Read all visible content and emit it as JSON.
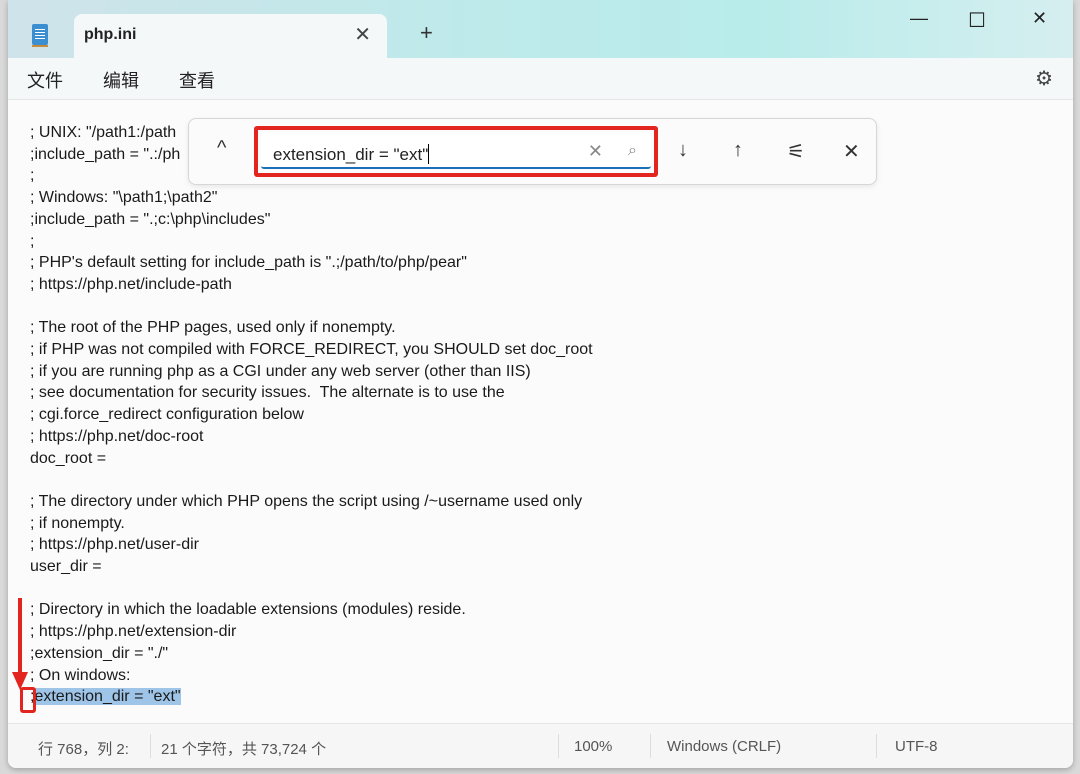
{
  "window": {
    "tab_title": "php.ini",
    "new_tab": "+",
    "tab_close": "✕",
    "minimize": "—",
    "maximize": "☐",
    "close": "✕"
  },
  "menu": {
    "file": "文件",
    "edit": "编辑",
    "view": "查看",
    "settings": "⚙"
  },
  "find": {
    "value": "extension_dir = \"ext\"",
    "collapse": "^",
    "clear": "✕",
    "search": "⌕",
    "next": "↓",
    "prev": "↑",
    "options": "⚟",
    "close": "✕"
  },
  "lines": [
    "; UNIX: \"/path1:/path",
    ";include_path = \".:/ph",
    ";",
    "; Windows: \"\\path1;\\path2\"",
    ";include_path = \".;c:\\php\\includes\"",
    ";",
    "; PHP's default setting for include_path is \".;/path/to/php/pear\"",
    "; https://php.net/include-path",
    "",
    "; The root of the PHP pages, used only if nonempty.",
    "; if PHP was not compiled with FORCE_REDIRECT, you SHOULD set doc_root",
    "; if you are running php as a CGI under any web server (other than IIS)",
    "; see documentation for security issues.  The alternate is to use the",
    "; cgi.force_redirect configuration below",
    "; https://php.net/doc-root",
    "doc_root =",
    "",
    "; The directory under which PHP opens the script using /~username used only",
    "; if nonempty.",
    "; https://php.net/user-dir",
    "user_dir =",
    "",
    "; Directory in which the loadable extensions (modules) reside.",
    "; https://php.net/extension-dir",
    ";extension_dir = \"./\"",
    "; On windows:"
  ],
  "selected_line": {
    "prefix": ";",
    "selected": "extension_dir = \"ext\""
  },
  "status": {
    "position": "行 768，列 2:",
    "selection": "21 个字符，共 73,724 个",
    "zoom": "100%",
    "line_ending": "Windows (CRLF)",
    "encoding": "UTF-8"
  }
}
